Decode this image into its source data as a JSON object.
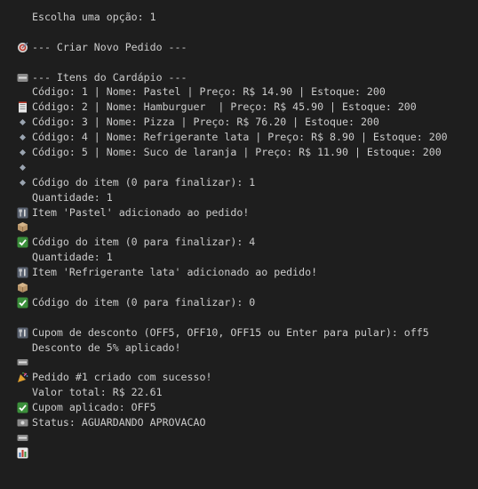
{
  "terminal": {
    "choice_line": "Escolha uma opção: 1",
    "create_header": "--- Criar Novo Pedido ---",
    "menu_header": "--- Itens do Cardápio ---",
    "menu_items": [
      "Código: 1 | Nome: Pastel | Preço: R$ 14.90 | Estoque: 200",
      "Código: 2 | Nome: Hamburguer  | Preço: R$ 45.90 | Estoque: 200",
      "Código: 3 | Nome: Pizza | Preço: R$ 76.20 | Estoque: 200",
      "Código: 4 | Nome: Refrigerante lata | Preço: R$ 8.90 | Estoque: 200",
      "Código: 5 | Nome: Suco de laranja | Preço: R$ 11.90 | Estoque: 200"
    ],
    "entry1_code": "Código do item (0 para finalizar): 1",
    "entry1_qty": "Quantidade: 1",
    "entry1_added": "Item 'Pastel' adicionado ao pedido!",
    "entry2_code": "Código do item (0 para finalizar): 4",
    "entry2_qty": "Quantidade: 1",
    "entry2_added": "Item 'Refrigerante lata' adicionado ao pedido!",
    "entry3_code": "Código do item (0 para finalizar): 0",
    "coupon_prompt": "Cupom de desconto (OFF5, OFF10, OFF15 ou Enter para pular): off5",
    "coupon_applied_msg": "Desconto de 5% aplicado!",
    "order_created": "Pedido #1 criado com sucesso!",
    "total_value": "Valor total: R$ 22.61",
    "coupon_used": "Cupom aplicado: OFF5",
    "status": "Status: AGUARDANDO APROVACAO"
  },
  "icons": {
    "choice": "target-icon",
    "create": "new-badge-icon",
    "menu": "receipt-icon",
    "menu_item": "diamond-bullet-icon",
    "code": "fork-knife-icon",
    "quantity": "package-icon",
    "check": "check-box-icon",
    "coupon": "ticket-icon",
    "party": "party-popper-icon",
    "money": "money-bill-icon",
    "status": "bar-chart-icon"
  },
  "colors": {
    "background": "#1e1e1e",
    "text": "#cccccc",
    "check_green": "#3b8f3b",
    "diamond_blue": "#7aa6d6"
  }
}
